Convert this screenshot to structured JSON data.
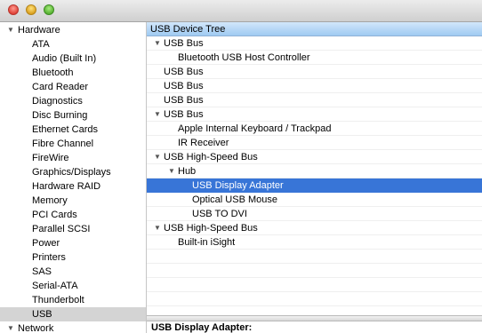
{
  "window": {
    "buttons": [
      "close",
      "minimize",
      "zoom"
    ]
  },
  "sidebar": {
    "items": [
      {
        "label": "Hardware",
        "expandable": true,
        "expanded": true,
        "level": 0
      },
      {
        "label": "ATA",
        "level": 1
      },
      {
        "label": "Audio (Built In)",
        "level": 1
      },
      {
        "label": "Bluetooth",
        "level": 1
      },
      {
        "label": "Card Reader",
        "level": 1
      },
      {
        "label": "Diagnostics",
        "level": 1
      },
      {
        "label": "Disc Burning",
        "level": 1
      },
      {
        "label": "Ethernet Cards",
        "level": 1
      },
      {
        "label": "Fibre Channel",
        "level": 1
      },
      {
        "label": "FireWire",
        "level": 1
      },
      {
        "label": "Graphics/Displays",
        "level": 1
      },
      {
        "label": "Hardware RAID",
        "level": 1
      },
      {
        "label": "Memory",
        "level": 1
      },
      {
        "label": "PCI Cards",
        "level": 1
      },
      {
        "label": "Parallel SCSI",
        "level": 1
      },
      {
        "label": "Power",
        "level": 1
      },
      {
        "label": "Printers",
        "level": 1
      },
      {
        "label": "SAS",
        "level": 1
      },
      {
        "label": "Serial-ATA",
        "level": 1
      },
      {
        "label": "Thunderbolt",
        "level": 1
      },
      {
        "label": "USB",
        "level": 1,
        "selected": true
      },
      {
        "label": "Network",
        "expandable": true,
        "expanded": true,
        "level": 0
      }
    ]
  },
  "main": {
    "header": "USB Device Tree",
    "tree": [
      {
        "label": "USB Bus",
        "level": 0,
        "expandable": true
      },
      {
        "label": "Bluetooth USB Host Controller",
        "level": 1
      },
      {
        "label": "USB Bus",
        "level": 0
      },
      {
        "label": "USB Bus",
        "level": 0
      },
      {
        "label": "USB Bus",
        "level": 0
      },
      {
        "label": "USB Bus",
        "level": 0,
        "expandable": true
      },
      {
        "label": "Apple Internal Keyboard / Trackpad",
        "level": 1
      },
      {
        "label": "IR Receiver",
        "level": 1
      },
      {
        "label": "USB High-Speed Bus",
        "level": 0,
        "expandable": true
      },
      {
        "label": "Hub",
        "level": 1,
        "expandable": true
      },
      {
        "label": "USB Display Adapter",
        "level": 2,
        "selected": true
      },
      {
        "label": "Optical USB Mouse",
        "level": 2
      },
      {
        "label": "USB TO DVI",
        "level": 2
      },
      {
        "label": "USB High-Speed Bus",
        "level": 0,
        "expandable": true
      },
      {
        "label": "Built-in iSight",
        "level": 1
      }
    ],
    "detail_title": "USB Display Adapter:"
  },
  "colors": {
    "selection": "#3875d7",
    "sidebar_selection": "#d4d4d4",
    "header_gradient_top": "#d2e7fb",
    "header_gradient_bottom": "#9fcaf2"
  },
  "icons": {
    "disclosure": "disclosure-triangle-down"
  }
}
